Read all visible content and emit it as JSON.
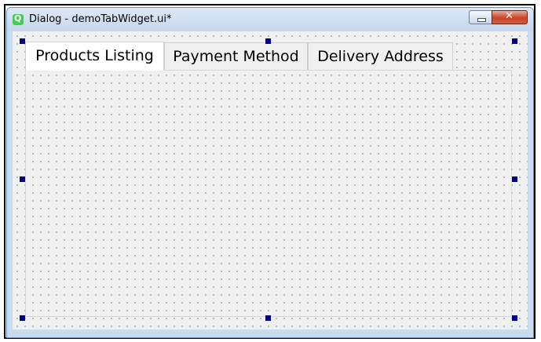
{
  "window": {
    "title": "Dialog - demoTabWidget.ui*"
  },
  "tabs": [
    {
      "label": "Products Listing",
      "active": true
    },
    {
      "label": "Payment Method",
      "active": false
    },
    {
      "label": "Delivery Address",
      "active": false
    }
  ],
  "colors": {
    "selection_handle": "#000080",
    "close_button": "#c8452c",
    "window_frame": "#c9d9ee"
  },
  "icons": {
    "app": "qt-logo-icon",
    "minimize": "minimize-icon",
    "close": "close-icon"
  }
}
